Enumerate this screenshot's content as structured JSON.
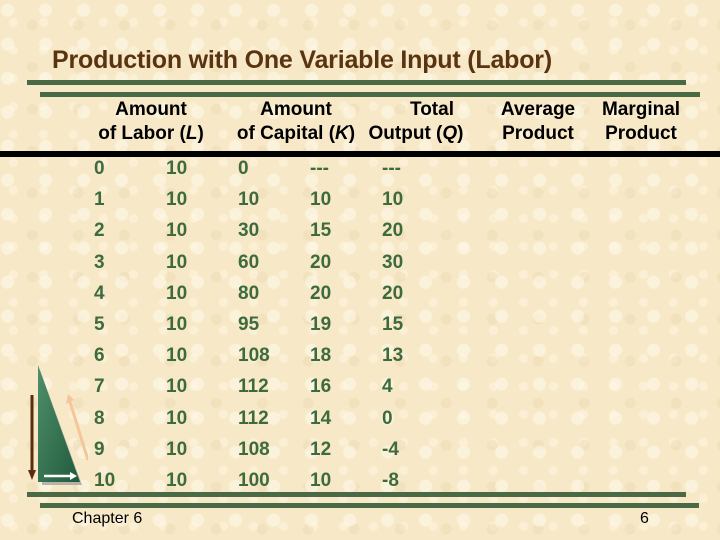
{
  "slide": {
    "title": "Production with One Variable Input (Labor)",
    "footer_left": "Chapter 6",
    "page_number": "6"
  },
  "table": {
    "headers": [
      {
        "line1": "Amount",
        "line2_pre": "of Labor (",
        "var": "L",
        "line2_post": ")"
      },
      {
        "line1": "Amount",
        "line2_pre": "of Capital (",
        "var": "K",
        "line2_post": ")"
      },
      {
        "line1": "Total",
        "line2_pre": "Output (",
        "var": "Q",
        "line2_post": ")"
      },
      {
        "line1": "Average",
        "line2_pre": "Product",
        "var": "",
        "line2_post": ""
      },
      {
        "line1": "Marginal",
        "line2_pre": "Product",
        "var": "",
        "line2_post": ""
      }
    ],
    "rows": [
      [
        "0",
        "10",
        "0",
        "---",
        "---"
      ],
      [
        "1",
        "10",
        "10",
        "10",
        "10"
      ],
      [
        "2",
        "10",
        "30",
        "15",
        "20"
      ],
      [
        "3",
        "10",
        "60",
        "20",
        "30"
      ],
      [
        "4",
        "10",
        "80",
        "20",
        "20"
      ],
      [
        "5",
        "10",
        "95",
        "19",
        "15"
      ],
      [
        "6",
        "10",
        "108",
        "18",
        "13"
      ],
      [
        "7",
        "10",
        "112",
        "16",
        "4"
      ],
      [
        "8",
        "10",
        "112",
        "14",
        "0"
      ],
      [
        "9",
        "10",
        "108",
        "12",
        "-4"
      ],
      [
        "10",
        "10",
        "100",
        "10",
        "-8"
      ]
    ]
  },
  "decoration": {
    "icon": "triangle-arrows-logo-icon"
  },
  "colors": {
    "title": "#5a3310",
    "rule": "#4a6a45",
    "cell_text": "#3d6b3e",
    "background": "#f7e9c8"
  }
}
